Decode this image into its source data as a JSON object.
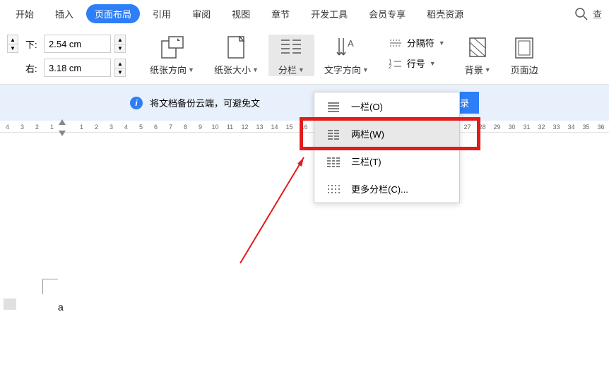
{
  "tabs": {
    "items": [
      "开始",
      "插入",
      "页面布局",
      "引用",
      "审阅",
      "视图",
      "章节",
      "开发工具",
      "会员专享",
      "稻壳资源"
    ],
    "active_index": 2
  },
  "margins": {
    "top_label": "下:",
    "top_value": "2.54 cm",
    "right_label": "右:",
    "right_value": "3.18 cm"
  },
  "tools": {
    "orientation": "纸张方向",
    "size": "纸张大小",
    "columns": "分栏",
    "text_direction": "文字方向",
    "breaks": "分隔符",
    "line_numbers": "行号",
    "background": "背景",
    "borders": "页面边"
  },
  "banner": {
    "text": "将文档备份云端，可避免文",
    "login": "立即登录"
  },
  "ruler": {
    "numbers": [
      "4",
      "3",
      "2",
      "1",
      "",
      "1",
      "2",
      "3",
      "4",
      "5",
      "6",
      "7",
      "8",
      "9",
      "10",
      "11",
      "12",
      "13",
      "14",
      "15",
      "16",
      "",
      "",
      "",
      "",
      "",
      "",
      "",
      "",
      "",
      "",
      "27",
      "28",
      "29",
      "30",
      "31",
      "32",
      "33",
      "34",
      "35",
      "36"
    ]
  },
  "columns_menu": {
    "one": "一栏(O)",
    "two": "两栏(W)",
    "three": "三栏(T)",
    "more": "更多分栏(C)..."
  },
  "doc": {
    "text": "a"
  }
}
